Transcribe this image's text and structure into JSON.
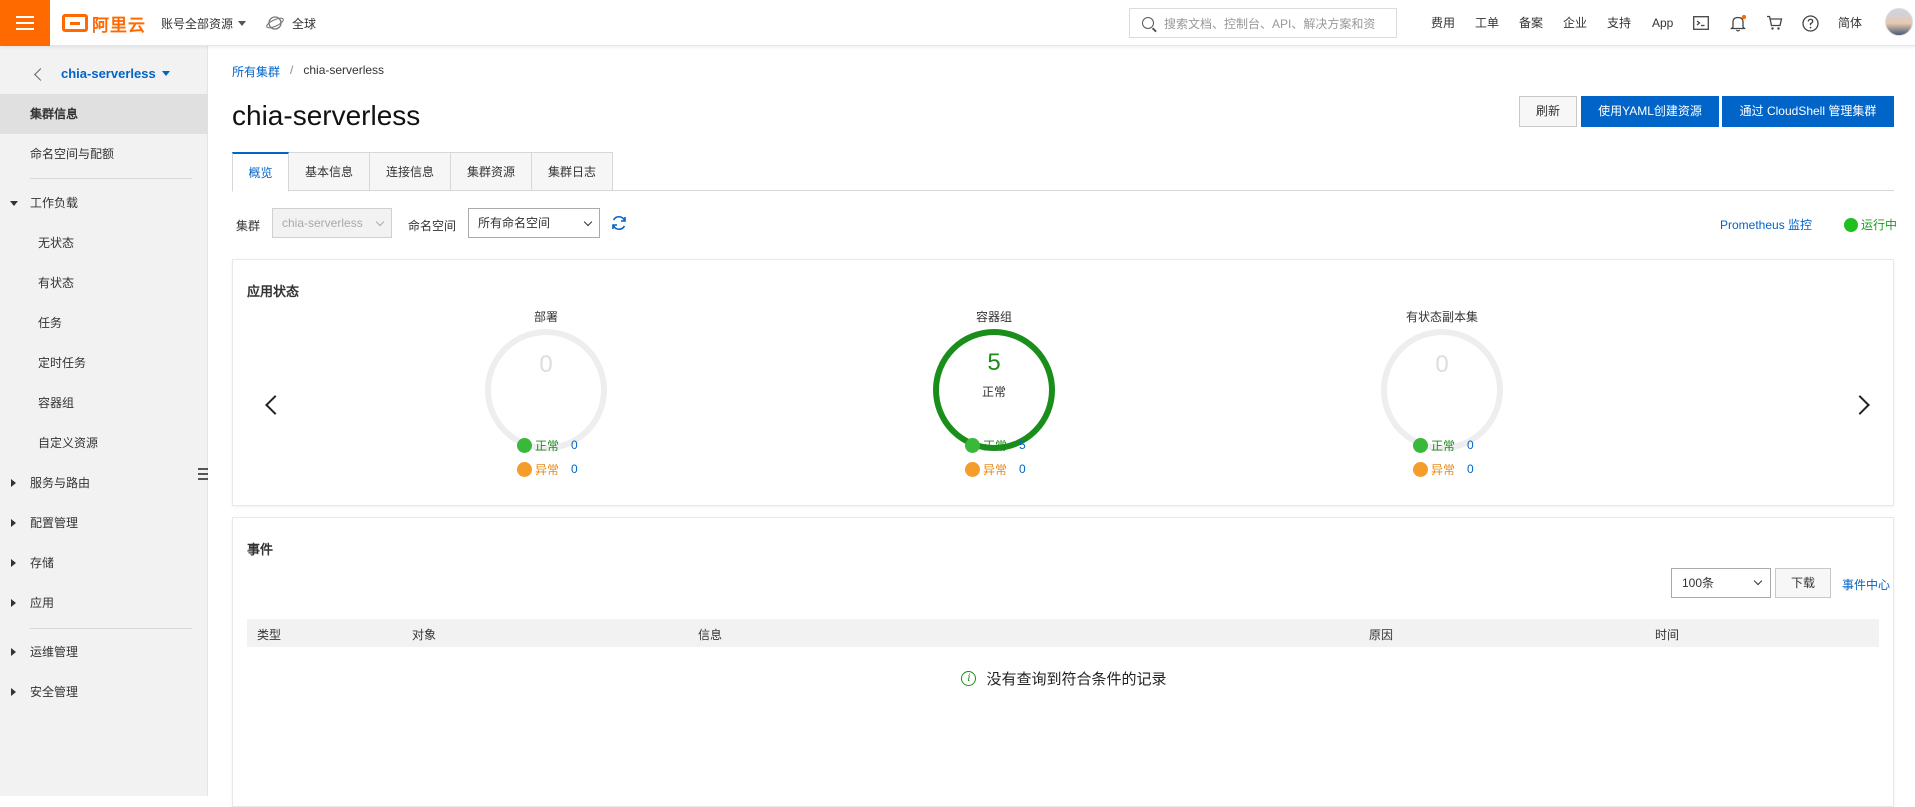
{
  "topbar": {
    "logo": "阿里云",
    "account_menu": "账号全部资源",
    "region": "全球",
    "search_placeholder": "搜索文档、控制台、API、解决方案和资",
    "links": [
      "费用",
      "工单",
      "备案",
      "企业",
      "支持",
      "App"
    ],
    "language": "简体"
  },
  "sidebar": {
    "cluster_name": "chia-serverless",
    "items": [
      {
        "label": "集群信息"
      },
      {
        "label": "命名空间与配额"
      },
      {
        "label": "工作负载"
      },
      {
        "label": "无状态"
      },
      {
        "label": "有状态"
      },
      {
        "label": "任务"
      },
      {
        "label": "定时任务"
      },
      {
        "label": "容器组"
      },
      {
        "label": "自定义资源"
      },
      {
        "label": "服务与路由"
      },
      {
        "label": "配置管理"
      },
      {
        "label": "存储"
      },
      {
        "label": "应用"
      },
      {
        "label": "运维管理"
      },
      {
        "label": "安全管理"
      }
    ]
  },
  "breadcrumb": {
    "root": "所有集群",
    "separator": "/",
    "current": "chia-serverless"
  },
  "page_title": "chia-serverless",
  "actions": {
    "refresh": "刷新",
    "yaml_create": "使用YAML创建资源",
    "cloudshell": "通过 CloudShell 管理集群"
  },
  "tabs": [
    {
      "label": "概览"
    },
    {
      "label": "基本信息"
    },
    {
      "label": "连接信息"
    },
    {
      "label": "集群资源"
    },
    {
      "label": "集群日志"
    }
  ],
  "filters": {
    "cluster_label": "集群",
    "cluster_value": "chia-serverless",
    "namespace_label": "命名空间",
    "namespace_value": "所有命名空间",
    "prometheus_link": "Prometheus 监控",
    "status": "运行中"
  },
  "app_status": {
    "title": "应用状态",
    "gauges": [
      {
        "label": "部署",
        "total": "0",
        "total_sub": "",
        "normal_label": "正常",
        "normal": "0",
        "abnormal_label": "异常",
        "abnormal": "0"
      },
      {
        "label": "容器组",
        "total": "5",
        "total_sub": "正常",
        "normal_label": "正常",
        "normal": "5",
        "abnormal_label": "异常",
        "abnormal": "0"
      },
      {
        "label": "有状态副本集",
        "total": "0",
        "total_sub": "",
        "normal_label": "正常",
        "normal": "0",
        "abnormal_label": "异常",
        "abnormal": "0"
      }
    ]
  },
  "events": {
    "title": "事件",
    "page_size": "100条",
    "download": "下载",
    "center_link": "事件中心",
    "columns": [
      "类型",
      "对象",
      "信息",
      "原因",
      "时间"
    ],
    "empty_text": "没有查询到符合条件的记录"
  },
  "colors": {
    "brand": "#ff6a00",
    "primary": "#0064c8",
    "ok": "#1a8e1a",
    "warn": "#f59d2a"
  }
}
